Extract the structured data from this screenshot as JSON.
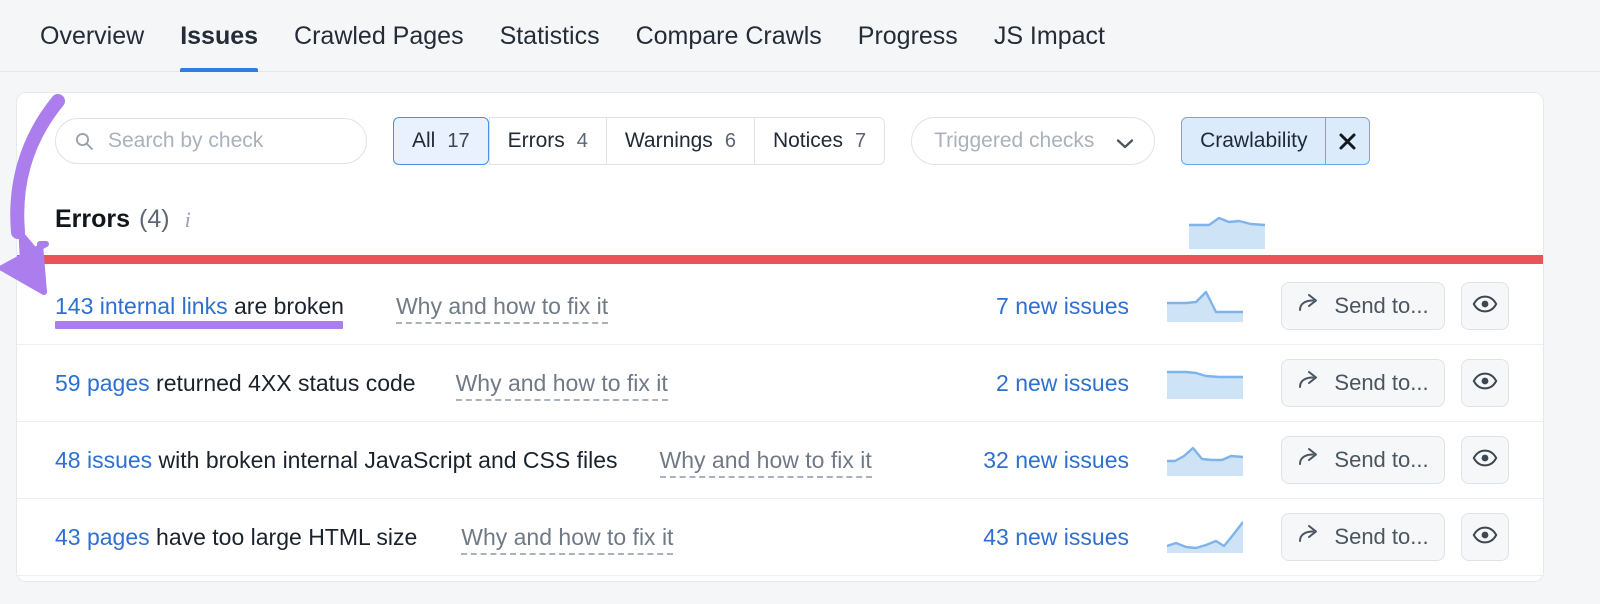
{
  "nav": {
    "tabs": [
      {
        "label": "Overview",
        "active": false
      },
      {
        "label": "Issues",
        "active": true
      },
      {
        "label": "Crawled Pages",
        "active": false
      },
      {
        "label": "Statistics",
        "active": false
      },
      {
        "label": "Compare Crawls",
        "active": false
      },
      {
        "label": "Progress",
        "active": false
      },
      {
        "label": "JS Impact",
        "active": false
      }
    ]
  },
  "filters": {
    "search": {
      "value": "",
      "placeholder": "Search by check",
      "icon": "search-icon"
    },
    "segments": [
      {
        "label": "All",
        "count": "17",
        "active": true
      },
      {
        "label": "Errors",
        "count": "4",
        "active": false
      },
      {
        "label": "Warnings",
        "count": "6",
        "active": false
      },
      {
        "label": "Notices",
        "count": "7",
        "active": false
      }
    ],
    "dropdown": {
      "label": "Triggered checks",
      "icon": "chevron-down-icon"
    },
    "chip": {
      "label": "Crawlability",
      "close_icon": "close-icon"
    }
  },
  "section": {
    "title": "Errors",
    "count": "(4)",
    "info_icon": "info-icon",
    "sparkline": {
      "values": [
        40,
        40,
        40,
        56,
        48,
        50,
        44,
        40
      ],
      "fill": "#cfe3f7",
      "stroke": "#7fb4ea"
    }
  },
  "colors": {
    "accent_blue": "#2f6fd0",
    "active_tab": "#2f7de1",
    "annotation_red": "#ea5459",
    "annotation_purple": "#ab7ded",
    "chip_bg": "#dcebfb",
    "chip_border": "#6aa9ef",
    "spark_fill": "#cfe3f7",
    "spark_stroke": "#7fb4ea"
  },
  "issues": [
    {
      "link_text": "143 internal links",
      "rest_text": " are broken",
      "fix_label": "Why and how to fix it",
      "new_issues": "7 new issues",
      "send_label": "Send to...",
      "send_icon": "share-arrow-icon",
      "eye_icon": "eye-icon",
      "sparkline": {
        "values": [
          42,
          42,
          42,
          44,
          72,
          30,
          30,
          30
        ]
      }
    },
    {
      "link_text": "59 pages",
      "rest_text": " returned 4XX status code",
      "fix_label": "Why and how to fix it",
      "new_issues": "2 new issues",
      "send_label": "Send to...",
      "send_icon": "share-arrow-icon",
      "eye_icon": "eye-icon",
      "sparkline": {
        "values": [
          66,
          66,
          66,
          60,
          54,
          52,
          52,
          52
        ]
      }
    },
    {
      "link_text": "48 issues",
      "rest_text": " with broken internal JavaScript and CSS files",
      "fix_label": "Why and how to fix it",
      "new_issues": "32 new issues",
      "send_label": "Send to...",
      "send_icon": "share-arrow-icon",
      "eye_icon": "eye-icon",
      "sparkline": {
        "values": [
          34,
          34,
          46,
          70,
          38,
          36,
          36,
          46,
          42
        ]
      }
    },
    {
      "link_text": "43 pages",
      "rest_text": " have too large HTML size",
      "fix_label": "Why and how to fix it",
      "new_issues": "43 new issues",
      "send_label": "Send to...",
      "send_icon": "share-arrow-icon",
      "eye_icon": "eye-icon",
      "sparkline": {
        "values": [
          14,
          22,
          12,
          10,
          16,
          26,
          14,
          40,
          78
        ]
      }
    }
  ],
  "annotations": {
    "arrow": {
      "color": "#ab7ded",
      "name": "curved-arrow-annotation"
    },
    "red_line": {
      "color": "#ea5459",
      "name": "red-line-annotation"
    },
    "purple_underline": {
      "color": "#ab7ded",
      "name": "purple-underline-annotation"
    }
  }
}
